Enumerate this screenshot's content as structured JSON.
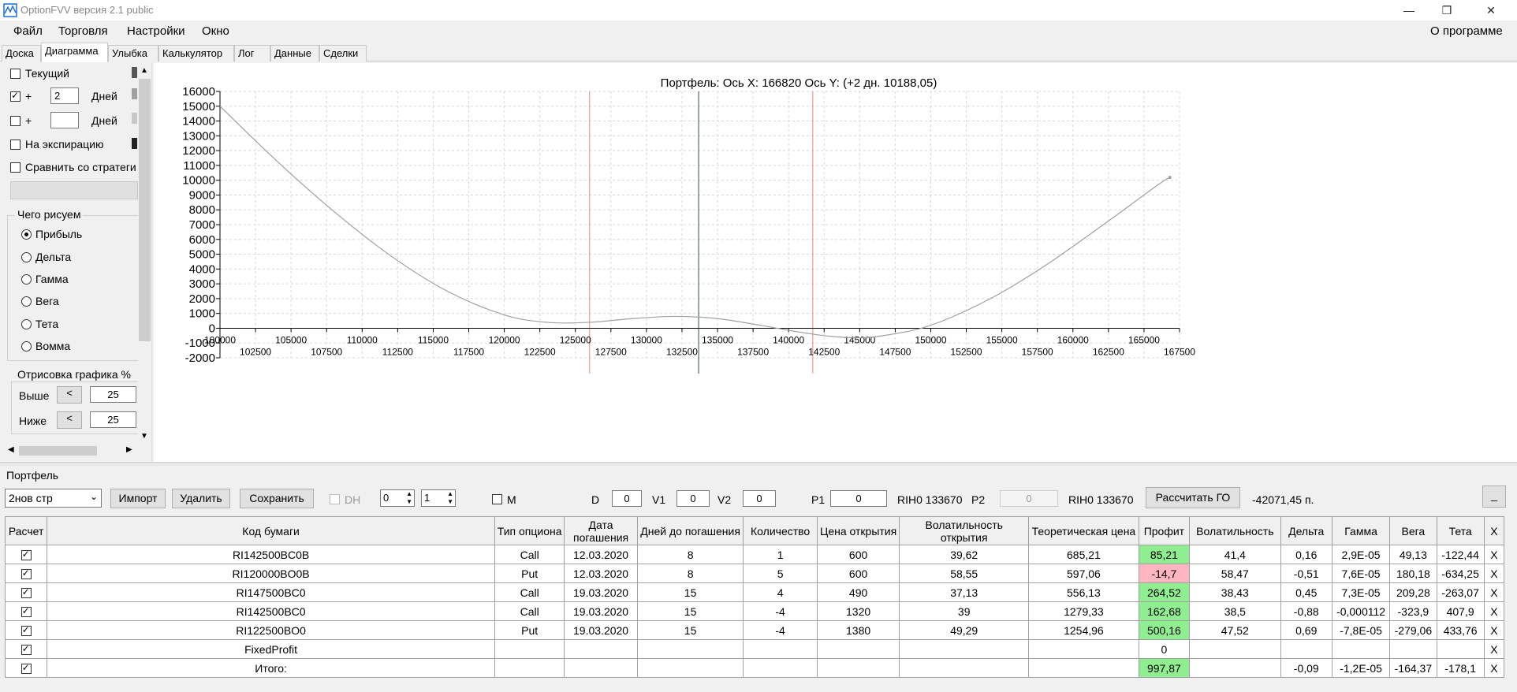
{
  "window": {
    "title": "OptionFVV версия 2.1 public",
    "controls": {
      "minimize": "—",
      "maximize": "❐",
      "close": "✕"
    }
  },
  "menu": {
    "items": [
      "Файл",
      "Торговля",
      "Настройки",
      "Окно"
    ],
    "about": "О программе"
  },
  "tabs": [
    "Доска",
    "Диаграмма",
    "Улыбка",
    "Калькулятор",
    "Лог",
    "Данные",
    "Сделки"
  ],
  "active_tab": 1,
  "left_panel": {
    "current_label": "Текущий",
    "plus_label": "+",
    "plus1_value": "2",
    "days_label": "Дней",
    "plus2_value": "",
    "expiration_label": "На экспирацию",
    "compare_label": "Сравнить со стратеги",
    "draw_group_title": "Чего рисуем",
    "draw_options": [
      "Прибыль",
      "Дельта",
      "Гамма",
      "Вега",
      "Тета",
      "Вомма"
    ],
    "draw_selected": 0,
    "render_group_title": "Отрисовка графика %",
    "above_label": "Выше",
    "below_label": "Ниже",
    "lt_button": "<",
    "above_value": "25",
    "below_value": "25",
    "colors": {
      "current": "#555555",
      "plus1": "#a0a0a0",
      "plus2": "#c8c8c8",
      "expiration": "#222222"
    }
  },
  "chart_data": {
    "type": "line",
    "title": "Портфель: Ось X: 166820 Ось Y:  (+2 дн. 10188,05)",
    "xlim": [
      100000,
      167500
    ],
    "ylim": [
      -2000,
      16000
    ],
    "yticks": [
      -2000,
      -1000,
      0,
      1000,
      2000,
      3000,
      4000,
      5000,
      6000,
      7000,
      8000,
      9000,
      10000,
      11000,
      12000,
      13000,
      14000,
      15000,
      16000
    ],
    "xticks_top": [
      100000,
      105000,
      110000,
      115000,
      120000,
      125000,
      130000,
      135000,
      140000,
      145000,
      150000,
      155000,
      160000,
      165000
    ],
    "xticks_bottom": [
      102500,
      107500,
      112500,
      117500,
      122500,
      127500,
      132500,
      137500,
      142500,
      147500,
      152500,
      157500,
      162500,
      167500
    ],
    "grid": true,
    "vlines": [
      {
        "x": 126000,
        "color": "#f08080"
      },
      {
        "x": 133670,
        "color": "#2f4f4f"
      },
      {
        "x": 141700,
        "color": "#f08080"
      }
    ],
    "series": [
      {
        "color": "#a0a0a0",
        "x": [
          100000,
          104000,
          108000,
          112000,
          116000,
          120000,
          123000,
          126000,
          129000,
          132000,
          135000,
          138000,
          141000,
          143000,
          145000,
          147000,
          150000,
          154000,
          158000,
          162000,
          166000,
          166820
        ],
        "y": [
          15000,
          11300,
          7900,
          4900,
          2500,
          900,
          400,
          400,
          650,
          800,
          650,
          200,
          -300,
          -550,
          -650,
          -450,
          200,
          1900,
          4200,
          6900,
          9700,
          10188
        ]
      }
    ]
  },
  "portfolio": {
    "label": "Портфель",
    "strategy_select": "2нов стр",
    "import_btn": "Импорт",
    "delete_btn": "Удалить",
    "save_btn": "Сохранить",
    "dh_label": "DH",
    "spin1": "0",
    "spin2": "1",
    "m_label": "M",
    "d_label": "D",
    "d_value": "0",
    "v1_label": "V1",
    "v1_value": "0",
    "v2_label": "V2",
    "v2_value": "0",
    "p1_label": "P1",
    "p1_value": "0",
    "p1_instrument": "RIH0 133670",
    "p2_label": "P2",
    "p2_value": "0",
    "p2_instrument": "RIH0 133670",
    "calc_btn": "Рассчитать ГО",
    "go_value": "-42071,45 п.",
    "collapse_btn": "_"
  },
  "table": {
    "headers": [
      "Расчет",
      "Код бумаги",
      "Тип опциона",
      "Дата погашения",
      "Дней до погашения",
      "Количество",
      "Цена открытия",
      "Волатильность открытия",
      "Теоретическая цена",
      "Профит",
      "Волатильность",
      "Дельта",
      "Гамма",
      "Вега",
      "Тета",
      "X"
    ],
    "rows": [
      {
        "code": "RI142500BC0B",
        "type": "Call",
        "date": "12.03.2020",
        "days": "8",
        "qty": "1",
        "price": "600",
        "vol_open": "39,62",
        "theo": "685,21",
        "profit": "85,21",
        "profit_sign": "pos",
        "vol": "41,4",
        "delta": "0,16",
        "gamma": "2,9E-05",
        "vega": "49,13",
        "theta": "-122,44",
        "x": "X"
      },
      {
        "code": "RI120000BO0B",
        "type": "Put",
        "date": "12.03.2020",
        "days": "8",
        "qty": "5",
        "price": "600",
        "vol_open": "58,55",
        "theo": "597,06",
        "profit": "-14,7",
        "profit_sign": "neg",
        "vol": "58,47",
        "delta": "-0,51",
        "gamma": "7,6E-05",
        "vega": "180,18",
        "theta": "-634,25",
        "x": "X"
      },
      {
        "code": "RI147500BC0",
        "type": "Call",
        "date": "19.03.2020",
        "days": "15",
        "qty": "4",
        "price": "490",
        "vol_open": "37,13",
        "theo": "556,13",
        "profit": "264,52",
        "profit_sign": "pos",
        "vol": "38,43",
        "delta": "0,45",
        "gamma": "7,3E-05",
        "vega": "209,28",
        "theta": "-263,07",
        "x": "X"
      },
      {
        "code": "RI142500BC0",
        "type": "Call",
        "date": "19.03.2020",
        "days": "15",
        "qty": "-4",
        "price": "1320",
        "vol_open": "39",
        "theo": "1279,33",
        "profit": "162,68",
        "profit_sign": "pos",
        "vol": "38,5",
        "delta": "-0,88",
        "gamma": "-0,000112",
        "vega": "-323,9",
        "theta": "407,9",
        "x": "X"
      },
      {
        "code": "RI122500BO0",
        "type": "Put",
        "date": "19.03.2020",
        "days": "15",
        "qty": "-4",
        "price": "1380",
        "vol_open": "49,29",
        "theo": "1254,96",
        "profit": "500,16",
        "profit_sign": "pos",
        "vol": "47,52",
        "delta": "0,69",
        "gamma": "-7,8E-05",
        "vega": "-279,06",
        "theta": "433,76",
        "x": "X"
      },
      {
        "code": "FixedProfit",
        "type": "",
        "date": "",
        "days": "",
        "qty": "",
        "price": "",
        "vol_open": "",
        "theo": "",
        "profit": "0",
        "profit_sign": "",
        "vol": "",
        "delta": "",
        "gamma": "",
        "vega": "",
        "theta": "",
        "x": "X"
      },
      {
        "code": "Итого:",
        "type": "",
        "date": "",
        "days": "",
        "qty": "",
        "price": "",
        "vol_open": "",
        "theo": "",
        "profit": "997,87",
        "profit_sign": "pos",
        "vol": "",
        "delta": "-0,09",
        "gamma": "-1,2E-05",
        "vega": "-164,37",
        "theta": "-178,1",
        "x": "X"
      }
    ]
  }
}
